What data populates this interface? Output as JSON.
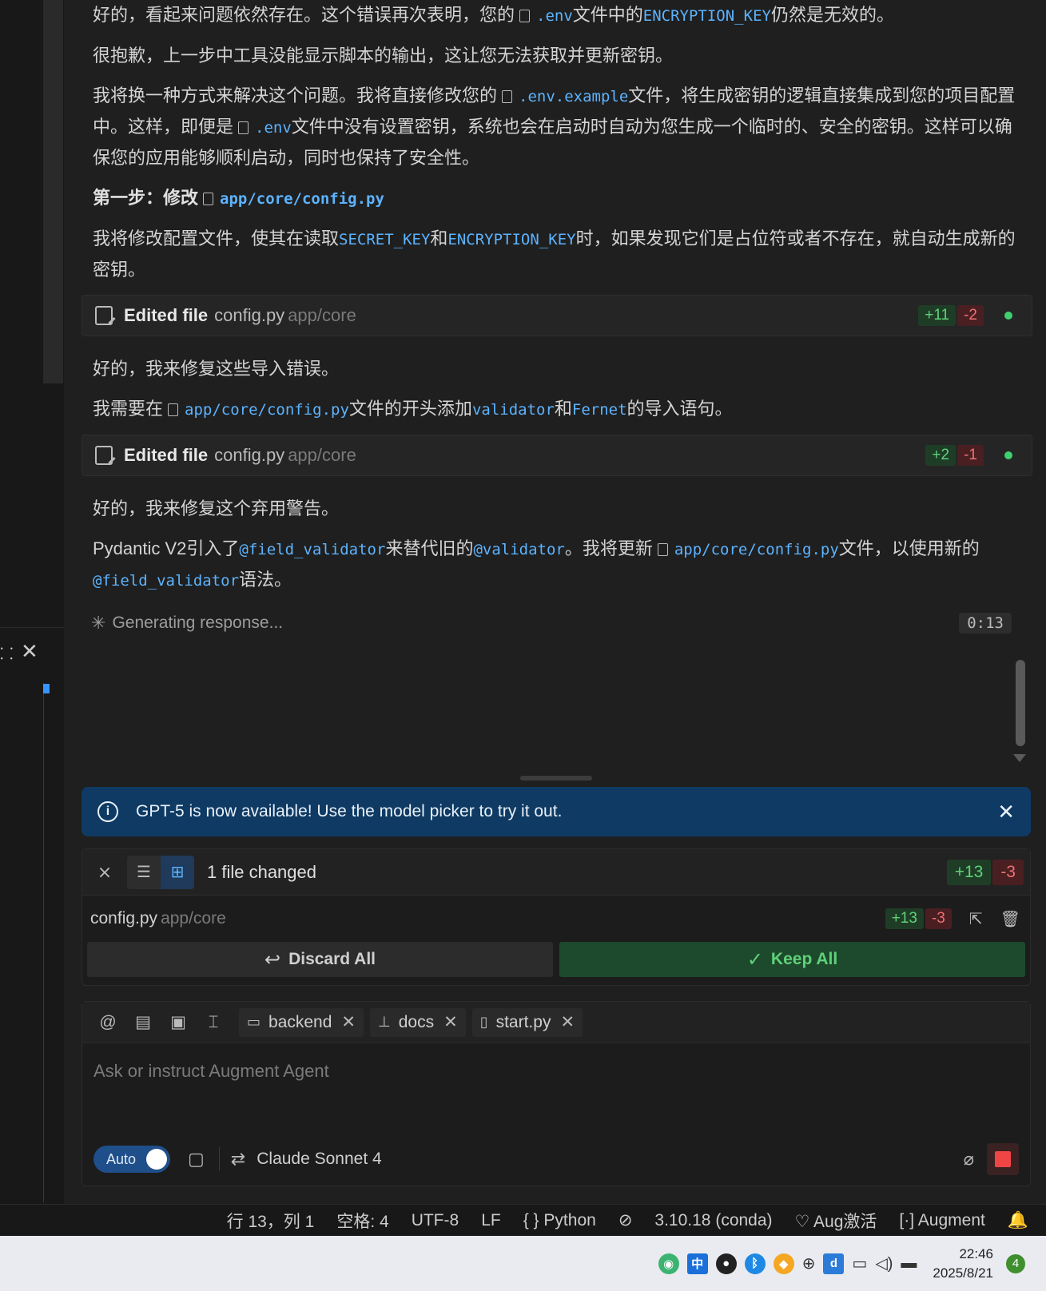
{
  "chat": {
    "p1": {
      "a": "好的，看起来问题依然存在。这个错误再次表明，您的",
      "file": ".env",
      "b": "文件中的",
      "code": "ENCRYPTION_KEY",
      "c": "仍然是无效的。"
    },
    "p2": "很抱歉，上一步中工具没能显示脚本的输出，这让您无法获取并更新密钥。",
    "p3": {
      "a": "我将换一种方式来解决这个问题。我将直接修改您的",
      "file1": ".env.example",
      "b": "文件，将生成密钥的逻辑直接集成到您的项目配置中。这样，即便是",
      "file2": ".env",
      "c": "文件中没有设置密钥，系统也会在启动时自动为您生成一个临时的、安全的密钥。这样可以确保您的应用能够顺利启动，同时也保持了安全性。"
    },
    "step_heading": "第一步：修改",
    "step_file": "app/core/config.py",
    "p4": {
      "a": "我将修改配置文件，使其在读取",
      "code1": "SECRET_KEY",
      "b": "和",
      "code2": "ENCRYPTION_KEY",
      "c": "时，如果发现它们是占位符或者不存在，就自动生成新的密钥。"
    },
    "edit1": {
      "label": "Edited file",
      "file": "config.py",
      "path": "app/core",
      "add": "+11",
      "del": "-2"
    },
    "p5": "好的，我来修复这些导入错误。",
    "p6": {
      "a": "我需要在",
      "file": "app/core/config.py",
      "b": "文件的开头添加",
      "code1": "validator",
      "c": "和",
      "code2": "Fernet",
      "d": "的导入语句。"
    },
    "edit2": {
      "label": "Edited file",
      "file": "config.py",
      "path": "app/core",
      "add": "+2",
      "del": "-1"
    },
    "p7": "好的，我来修复这个弃用警告。",
    "p8": {
      "a": "Pydantic V2引入了",
      "code1": "@field_validator",
      "b": "来替代旧的",
      "code2": "@validator",
      "c": "。我将更新",
      "file": "app/core/config.py",
      "d": "文件，以使用新的",
      "code3": "@field_validator",
      "e": "语法。"
    },
    "generating": "Generating response...",
    "timer": "0:13"
  },
  "banner": {
    "text": "GPT-5 is now available! Use the model picker to try it out."
  },
  "changes": {
    "title": "1 file changed",
    "add": "+13",
    "del": "-3",
    "file": "config.py",
    "path": "app/core",
    "file_add": "+13",
    "file_del": "-3",
    "discard_label": "Discard All",
    "keep_label": "Keep All"
  },
  "input": {
    "chips": [
      "backend",
      "docs",
      "start.py"
    ],
    "placeholder": "Ask or instruct Augment Agent",
    "auto_label": "Auto",
    "model": "Claude Sonnet 4"
  },
  "statusbar": {
    "position": "行 13，列 1",
    "spaces": "空格: 4",
    "encoding": "UTF-8",
    "eol": "LF",
    "language": "Python",
    "interpreter": "3.10.18 (conda)",
    "aug": "Aug激活",
    "augment": "Augment"
  },
  "taskbar": {
    "ime": "中",
    "time": "22:46",
    "date": "2025/8/21",
    "notifications": "4"
  },
  "colors": {
    "accent": "#3794ff",
    "add": "#5fd179",
    "del": "#f06f72",
    "banner": "#0e3a63"
  }
}
